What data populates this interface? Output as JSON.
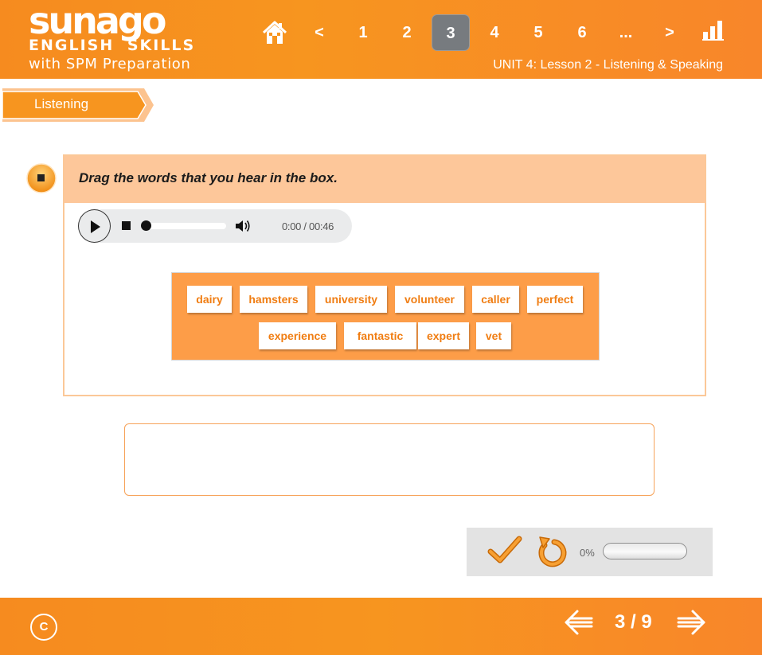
{
  "header": {
    "logo": {
      "brand": "sunago",
      "line2": "ENGLISH SKILLS",
      "line3": "with SPM Preparation"
    },
    "nav": {
      "prev": "<",
      "pages": [
        "1",
        "2",
        "3",
        "4",
        "5",
        "6"
      ],
      "active_page": "3",
      "ellipsis": "...",
      "next": ">"
    },
    "unit_label": "UNIT 4: Lesson 2 - Listening & Speaking"
  },
  "section_tab": "Listening",
  "question": {
    "instruction": "Drag the words that you hear in the box."
  },
  "audio": {
    "time": "0:00 / 00:46",
    "progress": 0
  },
  "word_bank": {
    "row1": [
      "dairy",
      "hamsters",
      "university",
      "volunteer",
      "caller",
      "perfect"
    ],
    "row2": [
      "experience",
      "fantastic",
      "expert",
      "vet"
    ]
  },
  "score": {
    "percent_label": "0%",
    "progress": 0
  },
  "footer": {
    "copyright": "C",
    "page_count": "3 / 9"
  },
  "colors": {
    "brand_orange": "#f68b1f",
    "word_bank_bg": "#fd9d48",
    "question_head_bg": "#fdc79a"
  }
}
